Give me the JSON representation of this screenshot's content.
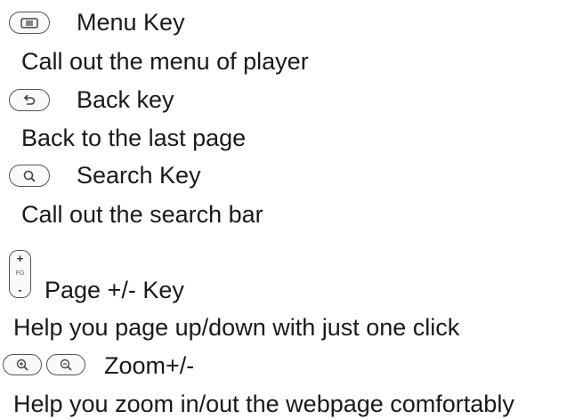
{
  "items": [
    {
      "icon": "menu-key-icon",
      "title": "Menu Key",
      "description": "Call out the menu of player"
    },
    {
      "icon": "back-key-icon",
      "title": "Back key",
      "description": "Back to the last page"
    },
    {
      "icon": "search-key-icon",
      "title": "Search Key",
      "description": "Call out the search bar"
    },
    {
      "icon": "page-key-icon",
      "title": "Page +/- Key",
      "description": "Help you page up/down with just one click"
    },
    {
      "icon": "zoom-keys-icon",
      "title": "Zoom+/-",
      "description": "Help you zoom in/out the webpage comfortably"
    }
  ],
  "page_key_icon": {
    "plus": "+",
    "label": "PG",
    "minus": "-"
  }
}
